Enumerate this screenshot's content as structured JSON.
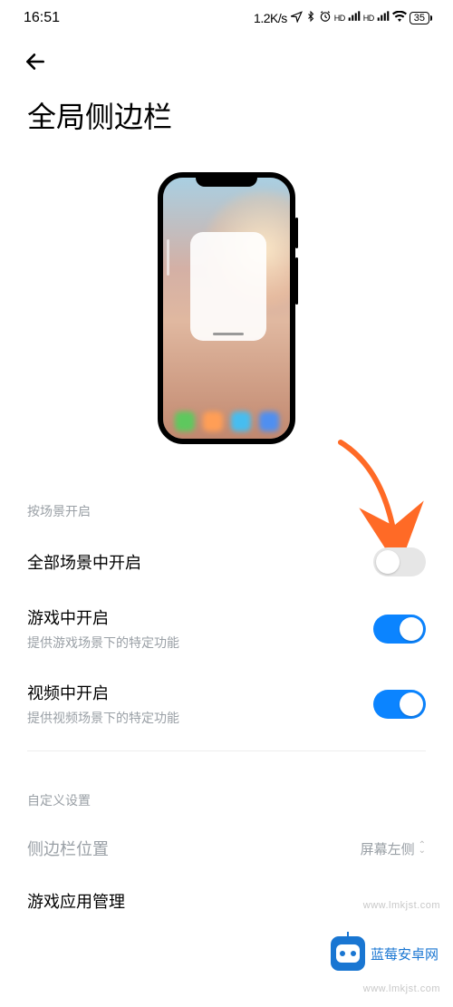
{
  "status": {
    "time": "16:51",
    "speed": "1.2K/s",
    "battery": "35"
  },
  "page": {
    "title": "全局侧边栏"
  },
  "section1": {
    "label": "按场景开启",
    "items": [
      {
        "title": "全部场景中开启",
        "sub": "",
        "on": false
      },
      {
        "title": "游戏中开启",
        "sub": "提供游戏场景下的特定功能",
        "on": true
      },
      {
        "title": "视频中开启",
        "sub": "提供视频场景下的特定功能",
        "on": true
      }
    ]
  },
  "section2": {
    "label": "自定义设置",
    "position": {
      "title": "侧边栏位置",
      "value": "屏幕左侧"
    },
    "game_mgmt": {
      "title": "游戏应用管理"
    }
  },
  "watermark": {
    "text": "www.lmkjst.com",
    "badge": "蓝莓安卓网"
  },
  "annotation": {
    "arrow_color": "#ff6a26"
  }
}
